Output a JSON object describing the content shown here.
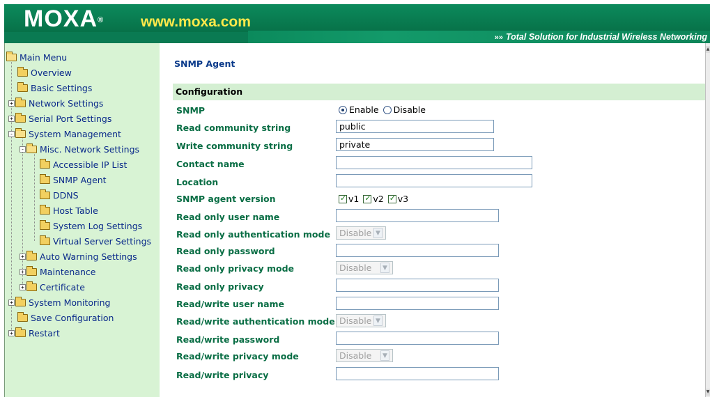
{
  "header": {
    "logo": "MOXA",
    "logo_mark": "®",
    "url": "www.moxa.com",
    "tagline_icon": "»»",
    "tagline": "Total Solution for Industrial Wireless Networking"
  },
  "sidebar": {
    "items": [
      {
        "label": "Main Menu",
        "expander": "",
        "icon": "open-folder-icon"
      },
      {
        "label": "Overview",
        "expander": "",
        "icon": "folder-icon"
      },
      {
        "label": "Basic Settings",
        "expander": "",
        "icon": "folder-icon"
      },
      {
        "label": "Network Settings",
        "expander": "+",
        "icon": "folder-icon"
      },
      {
        "label": "Serial Port Settings",
        "expander": "+",
        "icon": "folder-icon"
      },
      {
        "label": "System Management",
        "expander": "-",
        "icon": "open-folder-icon"
      },
      {
        "label": "Misc. Network Settings",
        "expander": "-",
        "icon": "open-folder-icon"
      },
      {
        "label": "Accessible IP List",
        "expander": "",
        "icon": "folder-icon"
      },
      {
        "label": "SNMP Agent",
        "expander": "",
        "icon": "folder-icon"
      },
      {
        "label": "DDNS",
        "expander": "",
        "icon": "folder-icon"
      },
      {
        "label": "Host Table",
        "expander": "",
        "icon": "folder-icon"
      },
      {
        "label": "System Log Settings",
        "expander": "",
        "icon": "folder-icon"
      },
      {
        "label": "Virtual Server Settings",
        "expander": "",
        "icon": "folder-icon"
      },
      {
        "label": "Auto Warning Settings",
        "expander": "+",
        "icon": "folder-icon"
      },
      {
        "label": "Maintenance",
        "expander": "+",
        "icon": "folder-icon"
      },
      {
        "label": "Certificate",
        "expander": "+",
        "icon": "folder-icon"
      },
      {
        "label": "System Monitoring",
        "expander": "+",
        "icon": "folder-icon"
      },
      {
        "label": "Save Configuration",
        "expander": "",
        "icon": "folder-icon"
      },
      {
        "label": "Restart",
        "expander": "+",
        "icon": "folder-icon"
      }
    ]
  },
  "main": {
    "title": "SNMP Agent",
    "section": "Configuration",
    "snmp": {
      "label": "SNMP",
      "enable": "Enable",
      "disable": "Disable",
      "selected": "Enable"
    },
    "read_community": {
      "label": "Read community string",
      "value": "public"
    },
    "write_community": {
      "label": "Write community string",
      "value": "private"
    },
    "contact": {
      "label": "Contact name",
      "value": ""
    },
    "location": {
      "label": "Location",
      "value": ""
    },
    "version": {
      "label": "SNMP agent version",
      "v1": "v1",
      "v2": "v2",
      "v3": "v3",
      "checked": [
        "v1",
        "v2",
        "v3"
      ]
    },
    "ro_user": {
      "label": "Read only user name",
      "value": ""
    },
    "ro_auth_mode": {
      "label": "Read only authentication mode",
      "value": "Disable"
    },
    "ro_password": {
      "label": "Read only password",
      "value": ""
    },
    "ro_privacy_mode": {
      "label": "Read only privacy mode",
      "value": "Disable"
    },
    "ro_privacy": {
      "label": "Read only privacy",
      "value": ""
    },
    "rw_user": {
      "label": "Read/write user name",
      "value": ""
    },
    "rw_auth_mode": {
      "label": "Read/write authentication mode",
      "value": "Disable"
    },
    "rw_password": {
      "label": "Read/write password",
      "value": ""
    },
    "rw_privacy_mode": {
      "label": "Read/write privacy mode",
      "value": "Disable"
    },
    "rw_privacy": {
      "label": "Read/write privacy",
      "value": ""
    }
  },
  "colors": {
    "header_green": "#0a7a52",
    "sidebar_bg": "#d8f3d4",
    "label_green": "#0a6e45",
    "url_yellow": "#ffe94a",
    "link_blue": "#0a2a8a"
  }
}
